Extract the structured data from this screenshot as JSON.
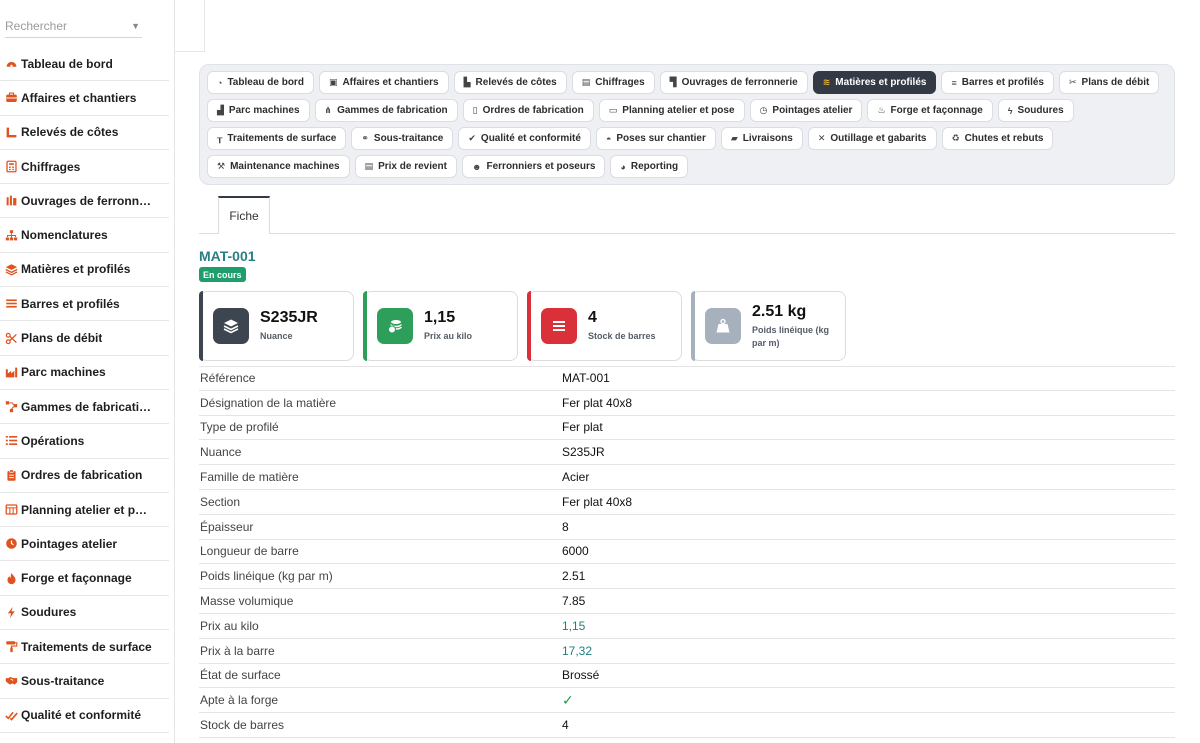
{
  "search": {
    "placeholder": "Rechercher"
  },
  "sidebar": {
    "items": [
      {
        "label": "Tableau de bord",
        "icon": "dashboard-icon"
      },
      {
        "label": "Affaires et chantiers",
        "icon": "briefcase-icon"
      },
      {
        "label": "Relevés de côtes",
        "icon": "ruler-icon"
      },
      {
        "label": "Chiffrages",
        "icon": "calculator-icon"
      },
      {
        "label": "Ouvrages de ferronn…",
        "icon": "gate-icon"
      },
      {
        "label": "Nomenclatures",
        "icon": "sitemap-icon"
      },
      {
        "label": "Matières et profilés",
        "icon": "layers-icon"
      },
      {
        "label": "Barres et profilés",
        "icon": "bars-icon"
      },
      {
        "label": "Plans de débit",
        "icon": "scissors-icon"
      },
      {
        "label": "Parc machines",
        "icon": "industry-icon"
      },
      {
        "label": "Gammes de fabricati…",
        "icon": "flow-icon"
      },
      {
        "label": "Opérations",
        "icon": "list-icon"
      },
      {
        "label": "Ordres de fabrication",
        "icon": "clipboard-icon"
      },
      {
        "label": "Planning atelier et p…",
        "icon": "calendar-icon"
      },
      {
        "label": "Pointages atelier",
        "icon": "clock-icon"
      },
      {
        "label": "Forge et façonnage",
        "icon": "fire-icon"
      },
      {
        "label": "Soudures",
        "icon": "bolt-icon"
      },
      {
        "label": "Traitements de surface",
        "icon": "paint-roller-icon"
      },
      {
        "label": "Sous-traitance",
        "icon": "handshake-icon"
      },
      {
        "label": "Qualité et conformité",
        "icon": "check-double-icon"
      }
    ]
  },
  "tabs": [
    {
      "label": "Tableau de bord",
      "icon": "dashboard-icon",
      "glyph": "◔"
    },
    {
      "label": "Affaires et chantiers",
      "icon": "briefcase-icon",
      "glyph": "▣"
    },
    {
      "label": "Relevés de côtes",
      "icon": "ruler-icon",
      "glyph": "▙"
    },
    {
      "label": "Chiffrages",
      "icon": "calculator-icon",
      "glyph": "▤"
    },
    {
      "label": "Ouvrages de ferronnerie",
      "icon": "gate-icon",
      "glyph": "▜"
    },
    {
      "label": "Matières et profilés",
      "icon": "layers-icon",
      "glyph": "≋",
      "active": true
    },
    {
      "label": "Barres et profilés",
      "icon": "bars-icon",
      "glyph": "≡"
    },
    {
      "label": "Plans de débit",
      "icon": "scissors-icon",
      "glyph": "✂"
    },
    {
      "label": "Parc machines",
      "icon": "industry-icon",
      "glyph": "▟"
    },
    {
      "label": "Gammes de fabrication",
      "icon": "flow-icon",
      "glyph": "⋔"
    },
    {
      "label": "Ordres de fabrication",
      "icon": "clipboard-icon",
      "glyph": "▯"
    },
    {
      "label": "Planning atelier et pose",
      "icon": "calendar-icon",
      "glyph": "▭"
    },
    {
      "label": "Pointages atelier",
      "icon": "clock-icon",
      "glyph": "◷"
    },
    {
      "label": "Forge et façonnage",
      "icon": "fire-icon",
      "glyph": "♨"
    },
    {
      "label": "Soudures",
      "icon": "bolt-icon",
      "glyph": "ϟ"
    },
    {
      "label": "Traitements de surface",
      "icon": "paint-roller-icon",
      "glyph": "┰"
    },
    {
      "label": "Sous-traitance",
      "icon": "handshake-icon",
      "glyph": "⚭"
    },
    {
      "label": "Qualité et conformité",
      "icon": "check-double-icon",
      "glyph": "✔"
    },
    {
      "label": "Poses sur chantier",
      "icon": "helmet-icon",
      "glyph": "◓"
    },
    {
      "label": "Livraisons",
      "icon": "truck-icon",
      "glyph": "▰"
    },
    {
      "label": "Outillage et gabarits",
      "icon": "tools-icon",
      "glyph": "✕"
    },
    {
      "label": "Chutes et rebuts",
      "icon": "recycle-icon",
      "glyph": "♻"
    },
    {
      "label": "Maintenance machines",
      "icon": "wrench-icon",
      "glyph": "⚒"
    },
    {
      "label": "Prix de revient",
      "icon": "receipt-icon",
      "glyph": "▤"
    },
    {
      "label": "Ferronniers et poseurs",
      "icon": "users-icon",
      "glyph": "☻"
    },
    {
      "label": "Reporting",
      "icon": "pie-chart-icon",
      "glyph": "◕"
    }
  ],
  "subtab": {
    "label": "Fiche"
  },
  "record": {
    "title": "MAT-001",
    "status": "En cours"
  },
  "cards": [
    {
      "value": "S235JR",
      "label": "Nuance",
      "icon": "layers-icon",
      "color": "#3d4550",
      "bar": "#3d4550"
    },
    {
      "value": "1,15",
      "label": "Prix au kilo",
      "icon": "coins-icon",
      "color": "#2e9e5b",
      "bar": "#2e9e5b"
    },
    {
      "value": "4",
      "label": "Stock de barres",
      "icon": "list-icon",
      "color": "#d9303a",
      "bar": "#d9303a"
    },
    {
      "value": "2.51 kg",
      "label": "Poids linéique (kg par m)",
      "icon": "weight-icon",
      "color": "#a7b0bd",
      "bar": "#a7b0bd"
    }
  ],
  "fields": [
    {
      "key": "Référence",
      "value": "MAT-001"
    },
    {
      "key": "Désignation de la matière",
      "value": "Fer plat 40x8"
    },
    {
      "key": "Type de profilé",
      "value": "Fer plat"
    },
    {
      "key": "Nuance",
      "value": "S235JR"
    },
    {
      "key": "Famille de matière",
      "value": "Acier"
    },
    {
      "key": "Section",
      "value": "Fer plat 40x8"
    },
    {
      "key": "Épaisseur",
      "value": "8"
    },
    {
      "key": "Longueur de barre",
      "value": "6000"
    },
    {
      "key": "Poids linéique (kg par m)",
      "value": "2.51"
    },
    {
      "key": "Masse volumique",
      "value": "7.85"
    },
    {
      "key": "Prix au kilo",
      "value": "1,15",
      "style": "teal"
    },
    {
      "key": "Prix à la barre",
      "value": "17,32",
      "style": "teal"
    },
    {
      "key": "État de surface",
      "value": "Brossé"
    },
    {
      "key": "Apte à la forge",
      "value": "",
      "check": true
    },
    {
      "key": "Stock de barres",
      "value": "4"
    }
  ]
}
